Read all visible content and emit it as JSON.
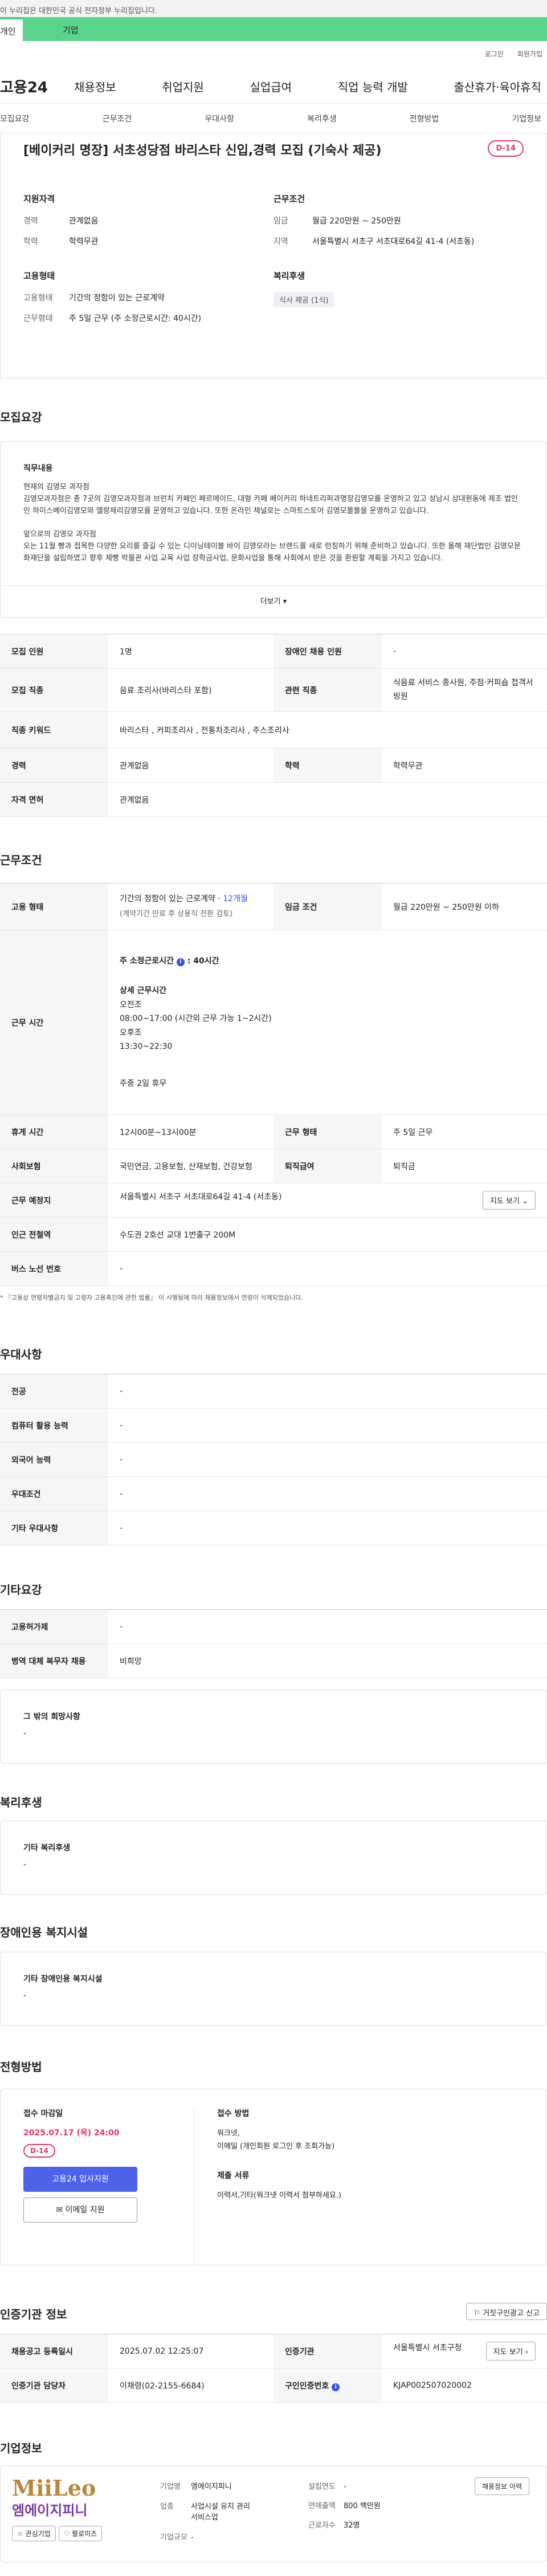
{
  "notice": "이 누리집은 대한민국 공식 전자정부 누리집입니다.",
  "top_tabs": {
    "personal": "개인",
    "company": "기업"
  },
  "util": {
    "login": "로그인",
    "signup": "회원가입"
  },
  "logo": "고용24",
  "gnb": [
    "채용정보",
    "취업지원",
    "실업급여",
    "직업 능력 개발",
    "출산휴가·육아휴직"
  ],
  "subnav": [
    "모집요강",
    "근무조건",
    "우대사항",
    "복리후생",
    "전형방법",
    "기업정보"
  ],
  "job": {
    "title": "[베이커리 명장] 서초성당점 바리스타 신입,경력 모집 (기숙사 제공)",
    "dday": "D-14",
    "qual_head": "지원자격",
    "career_k": "경력",
    "career_v": "관계없음",
    "edu_k": "학력",
    "edu_v": "학력무관",
    "emp_head": "고용형태",
    "emptype_k": "고용형태",
    "emptype_v": "기간의 정함이 있는 근로계약",
    "worktype_k": "근무형태",
    "worktype_v": "주 5일 근무 (주 소정근로시간: 40시간)",
    "cond_head": "근무조건",
    "wage_k": "임금",
    "wage_v": "월급 220만원 ~ 250만원",
    "region_k": "지역",
    "region_v": "서울특별시 서초구 서초대로64길 41-4 (서초동)",
    "welfare_head": "복리후생",
    "welfare_pill": "식사 제공 (1식)"
  },
  "recruit": {
    "title": "모집요강",
    "duty_head": "직무내용",
    "duty_text": "현재의 김영모 과자점\n김영모과자점은 총 7곳의 김영모과자점과 브런치 카페인 페르에이드, 대형 카페 베이커리 하네트리퍼과명장김영모를 운영하고 있고 성남시 상대원동에 제조 법인인 하미스베이김영모와 엘랑제리김영모를 운영하고 있습니다. 또한 온라인 채널로는 스마트스토어 김영모몰몰을 운영하고 있습니다.\n\n앞으로의 김영모 과자점\n오는 11월 빵과 접목한 다양한 요리를 즐길 수 있는 디이닝테이블 바이 김영모라는 브랜드를 새로 런칭하기 위해 준비하고 있습니다. 또한 올해 재단법인 김영모문화재단을 설립하였고 향후 제빵 박물관 사업 교육 사업 장학금사업, 문화사업을 통해 사회에서 받은 것을 환원할 계획을 가지고 있습니다.",
    "more": "더보기",
    "rows": {
      "count_k": "모집 인원",
      "count_v": "1명",
      "disabled_k": "장애인 채용 인원",
      "disabled_v": "-",
      "job_k": "모집 직종",
      "job_v": "음료 조리사(바리스타 포함)",
      "related_k": "관련 직종",
      "related_v": "식음료 서비스 종사원, 주점·커피숍 접객서빙원",
      "kw_k": "직종 키워드",
      "kw_v": "바리스타 , 커피조리사 , 전통차조리사 , 주스조리사",
      "career_k": "경력",
      "career_v": "관계없음",
      "edu_k": "학력",
      "edu_v": "학력무관",
      "license_k": "자격 면허",
      "license_v": "관계없음"
    }
  },
  "work": {
    "title": "근무조건",
    "emptype_k": "고용 형태",
    "emptype_v": "기간의 정함이 있는 근로계약 · ",
    "emptype_months": "12개월",
    "emptype_note": "(계약기간 만료 후 상용직 전환 검토)",
    "wage_k": "임금 조건",
    "wage_v": "월급 220만원 ~ 250만원 이하",
    "hours_k": "근무 시간",
    "hours_week": "주 소정근로시간",
    "hours_week_v": ": 40시간",
    "detail_head": "상세 근무시간",
    "detail_lines": [
      "오전조",
      "08:00~17:00 (시간외 근무 가능 1~2시간)",
      "오후조",
      "13:30~22:30"
    ],
    "detail_off": "주중 2일 휴무",
    "break_k": "휴게 시간",
    "break_v": "12시00분~13시00분",
    "form_k": "근무 형태",
    "form_v": "주 5일 근무",
    "insurance_k": "사회보험",
    "insurance_v": "국민연금, 고용보험, 산재보험, 건강보험",
    "retire_k": "퇴직급여",
    "retire_v": "퇴직금",
    "place_k": "근무 예정지",
    "place_v": "서울특별시 서초구 서초대로64길 41-4 (서초동)",
    "map_btn": "지도 보기",
    "station_k": "인근 전철역",
    "station_v": "수도권 2호선 교대 1번출구 200M",
    "bus_k": "버스 노선 번호",
    "bus_v": "-",
    "footnote": "* 『고용상 연령차별금지 및 고령자 고용촉진에 관한 법률』 이 시행됨에 따라 채용정보에서 연령이 삭제되었습니다."
  },
  "pref": {
    "title": "우대사항",
    "rows": [
      {
        "k": "전공",
        "v": "-"
      },
      {
        "k": "컴퓨터 활용 능력",
        "v": "-"
      },
      {
        "k": "외국어 능력",
        "v": "-"
      },
      {
        "k": "우대조건",
        "v": "-"
      },
      {
        "k": "기타 우대사항",
        "v": "-"
      }
    ]
  },
  "etc": {
    "title": "기타요강",
    "rows": [
      {
        "k": "고용허가제",
        "v": "-"
      },
      {
        "k": "병역 대체 복무자 채용",
        "v": "비희망"
      }
    ],
    "other_head": "그 밖의 희망사항",
    "other_v": "-"
  },
  "welfare": {
    "title": "복리후생",
    "head": "기타 복리후생",
    "v": "-"
  },
  "disabled": {
    "title": "장애인용 복지시설",
    "head": "기타 장애인용 복지시설",
    "v": "-"
  },
  "selection": {
    "title": "전형방법",
    "deadline_head": "접수 마감일",
    "deadline_v": "2025.07.17 (목) 24:00",
    "dday": "D-14",
    "apply_btn": "고용24 입사지원",
    "email_btn": "이메일 지원",
    "method_head": "접수 방법",
    "method_v": "워크넷,\n이메일 (개인회원 로그인 후 조회가능)",
    "docs_head": "제출 서류",
    "docs_v": "이력서,기타(워크넷 이력서 첨부하세요.)"
  },
  "agency": {
    "title": "인증기관 정보",
    "report_btn": "거짓구인광고 신고",
    "reg_k": "채용공고 등록일시",
    "reg_v": "2025.07.02 12:25:07",
    "org_k": "인증기관",
    "org_v": "서울특별시 서초구청",
    "map_btn": "지도 보기",
    "mgr_k": "인증기관 담당자",
    "mgr_v": "이채령(02-2155-6684)",
    "num_k": "구인인증번호",
    "num_v": "KJAP002507020002"
  },
  "company": {
    "title": "기업정보",
    "logo_text": "MiiLeo",
    "logo_sub": "엠에이지피니",
    "fav_btn": "관심기업",
    "follow_btn": "팔로미츠",
    "name_k": "기업명",
    "name_v": "엠에이지피니",
    "founded_k": "설립연도",
    "founded_v": "-",
    "biz_k": "업종",
    "biz_v": "사업시설 유지 관리 서비스업",
    "sales_k": "연매출액",
    "sales_v": "800 백만원",
    "staff_k": "근로자수",
    "staff_v": "32명",
    "size_k": "기업규모",
    "size_v": "-",
    "jobs_btn": "채용정보 이력"
  }
}
